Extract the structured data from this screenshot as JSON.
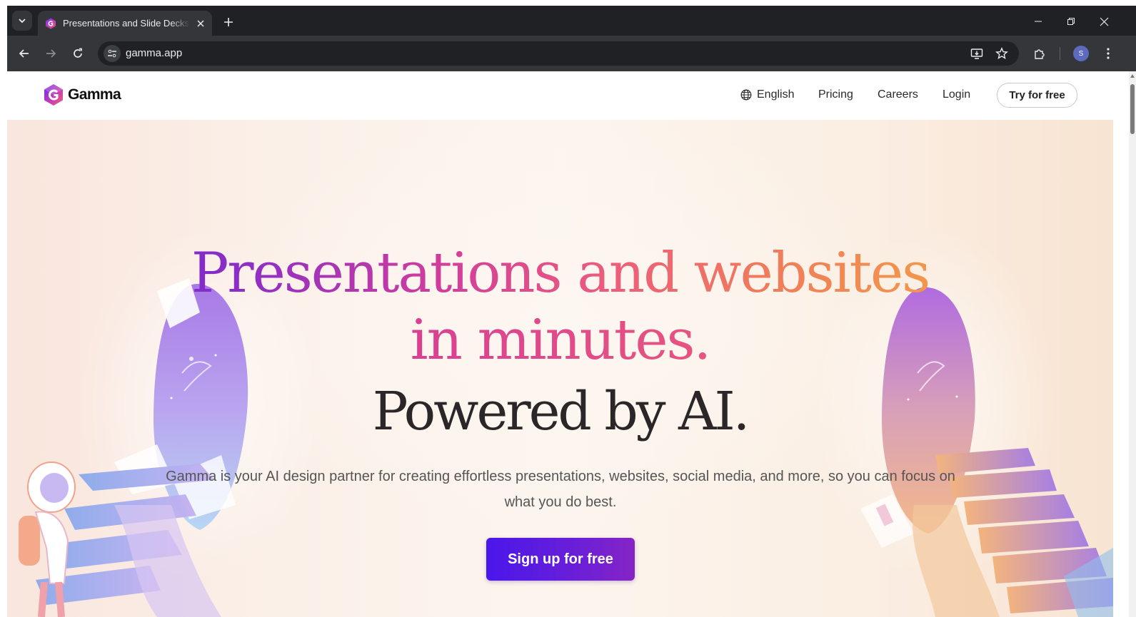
{
  "browser": {
    "tab_title": "Presentations and Slide Decks with AI",
    "url": "gamma.app",
    "profile_initial": "S"
  },
  "site": {
    "brand": "Gamma",
    "nav": {
      "language": "English",
      "pricing": "Pricing",
      "careers": "Careers",
      "login": "Login",
      "try_free": "Try for free"
    }
  },
  "hero": {
    "headline_line1": "Presentations and websites",
    "headline_line2": "in minutes.",
    "subheadline": "Powered by AI.",
    "description": "Gamma is your AI design partner for creating effortless presentations, websites, social media, and more, so you can focus on what you do best.",
    "cta_label": "Sign up for free"
  },
  "colors": {
    "brand_purple": "#5b21d9",
    "cta_start": "#4a17ea",
    "cta_end": "#8624c6",
    "accent_orange": "#f39a4a",
    "accent_pink": "#d93e94"
  },
  "icons": [
    "tab-search-icon",
    "gamma-favicon-icon",
    "close-icon",
    "plus-icon",
    "minimize-icon",
    "restore-icon",
    "back-icon",
    "forward-icon",
    "reload-icon",
    "site-info-icon",
    "install-app-icon",
    "star-icon",
    "extensions-icon",
    "kebab-menu-icon",
    "globe-icon",
    "gamma-logo-icon"
  ]
}
